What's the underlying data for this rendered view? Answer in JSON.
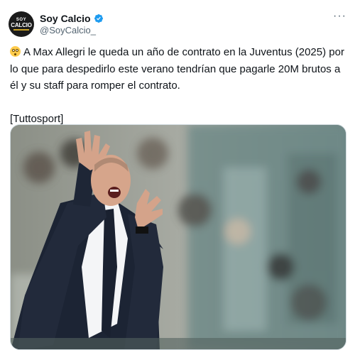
{
  "account": {
    "name": "Soy Calcio",
    "handle": "@SoyCalcio_",
    "avatar_line1": "SOY",
    "avatar_line2": "CALCIO",
    "verified": true,
    "more_label": "···"
  },
  "tweet": {
    "emoji": "flushed-face-emoji",
    "text": "A Max Allegri le queda un año de contrato en la Juventus (2025) por lo que para despedirlo este verano tendrían que pagarle 20M brutos a él y su staff para romper el contrato.",
    "source": "[Tuttosport]"
  },
  "colors": {
    "text": "#0f1419",
    "secondary": "#536471",
    "verified": "#1d9bf0",
    "border": "#cfd9de"
  }
}
